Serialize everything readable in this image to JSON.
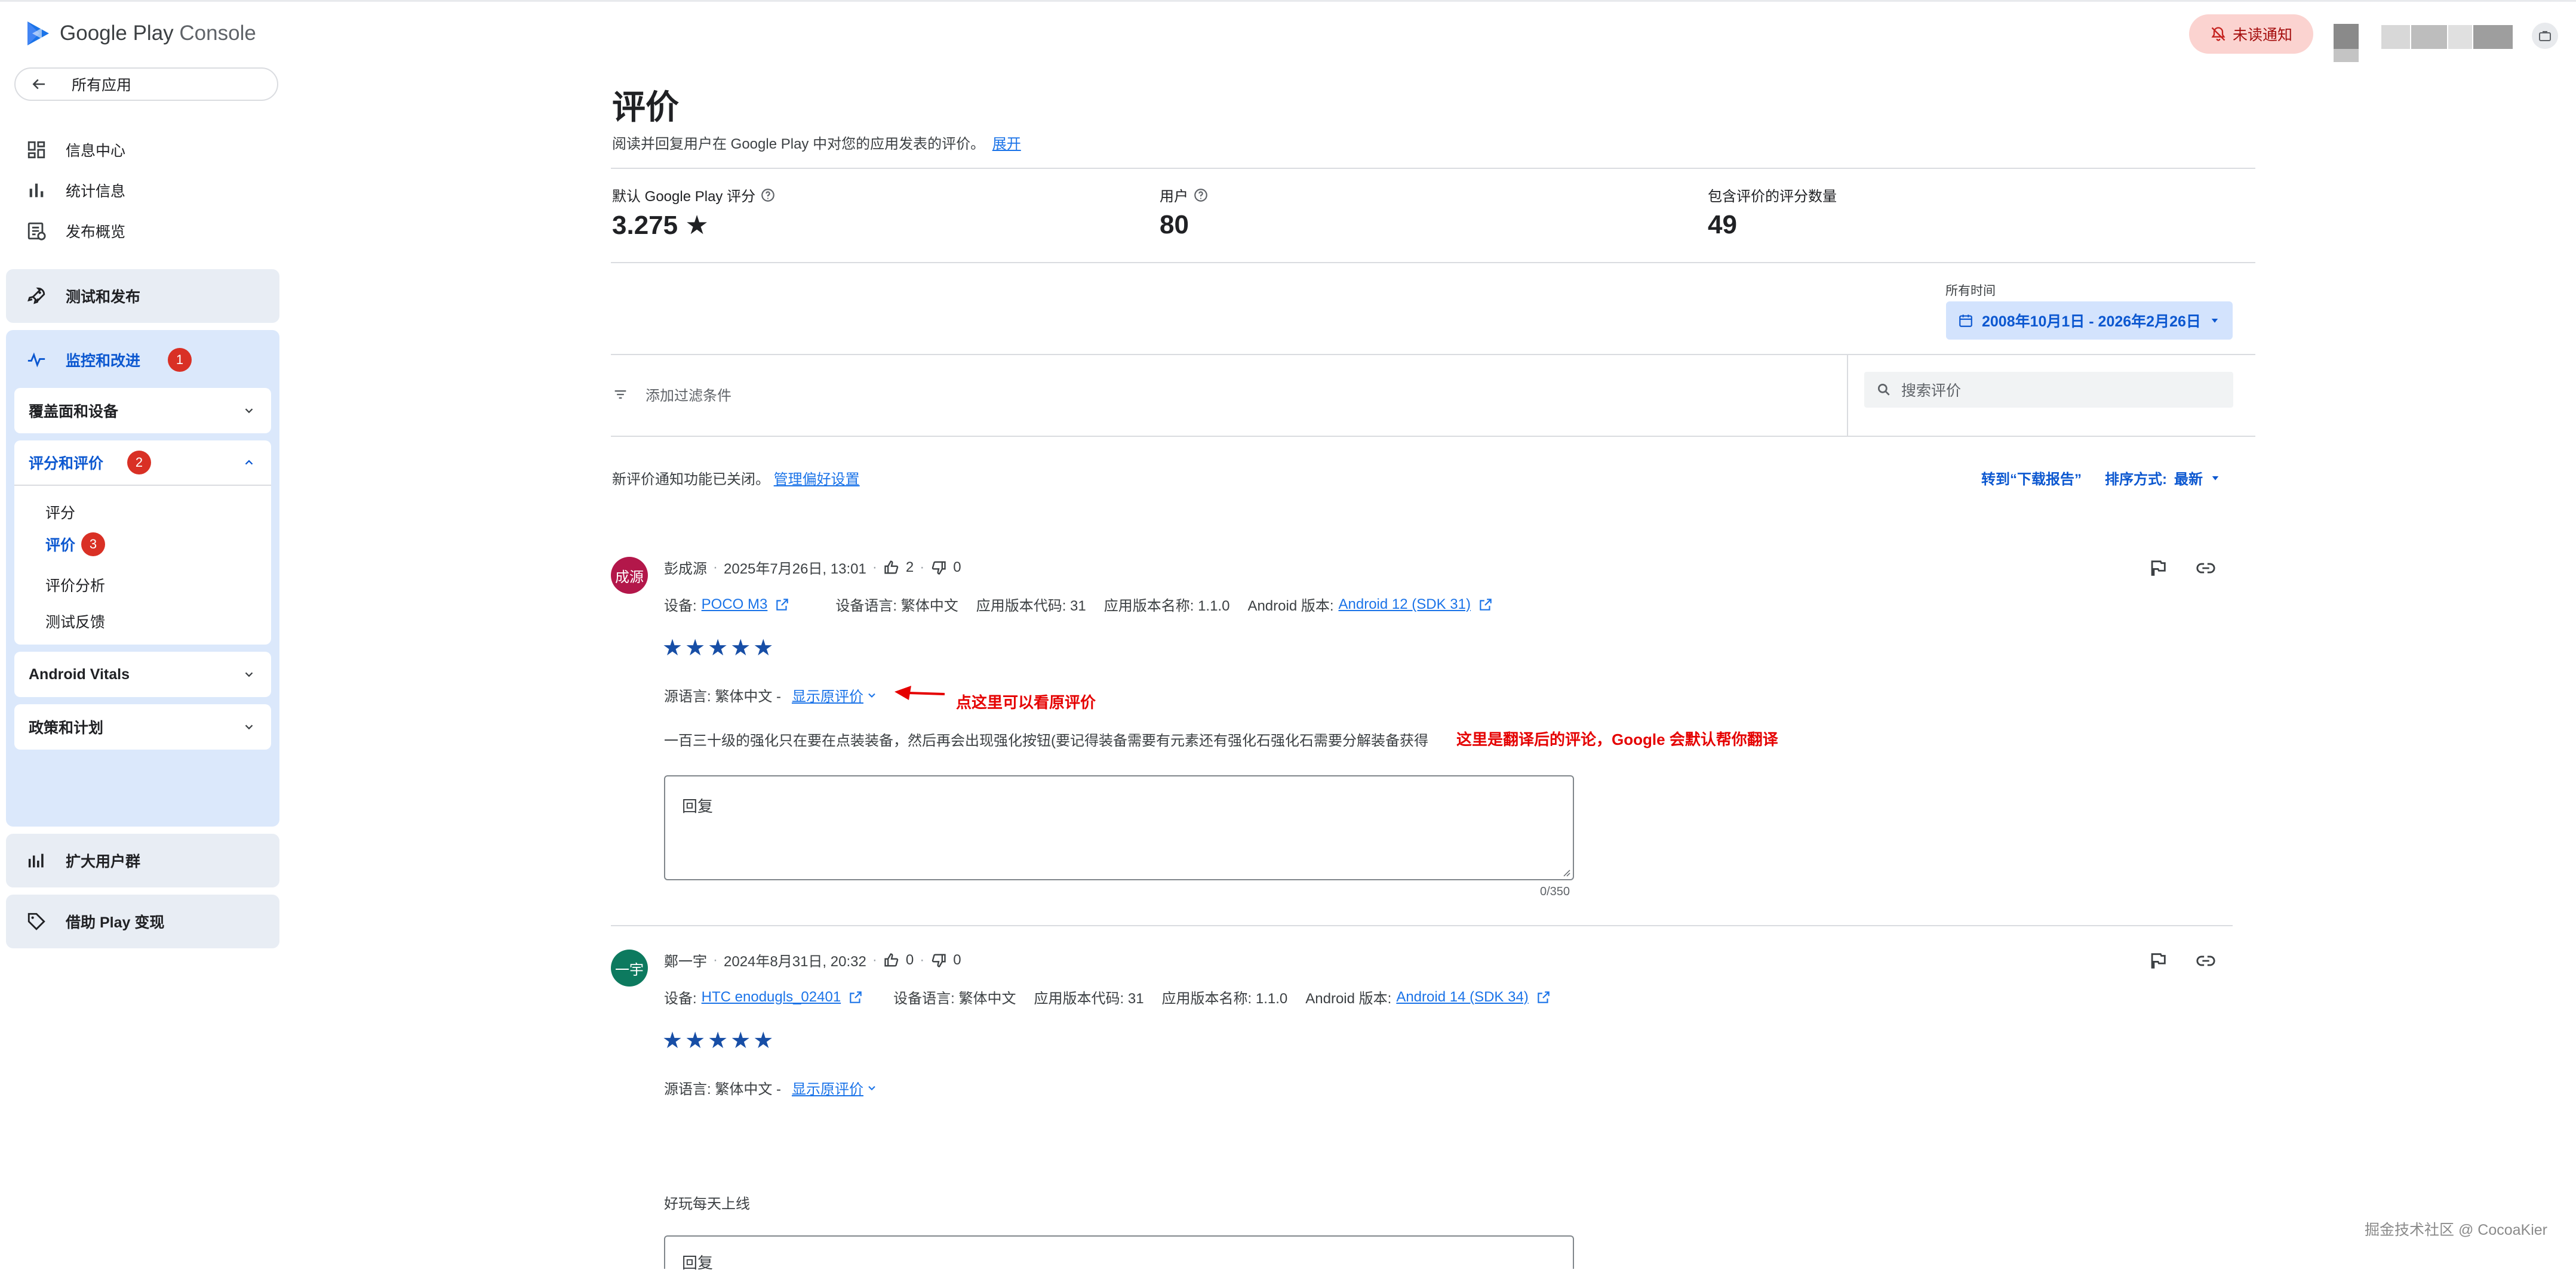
{
  "app": {
    "logo_google": "Google Play",
    "logo_console": "Console"
  },
  "topbar": {
    "notification_label": "未读通知"
  },
  "sidebar": {
    "back_label": "所有应用",
    "items": [
      {
        "label": "信息中心",
        "icon": "dashboard-icon"
      },
      {
        "label": "统计信息",
        "icon": "bar-chart-icon"
      },
      {
        "label": "发布概览",
        "icon": "release-icon"
      }
    ],
    "test_release": "测试和发布",
    "monitor": {
      "label": "监控和改进",
      "badge": "1"
    },
    "coverage": "覆盖面和设备",
    "ratings_section": {
      "label": "评分和评价",
      "badge": "2"
    },
    "sub_items": [
      {
        "label": "评分"
      },
      {
        "label": "评价",
        "badge": "3"
      },
      {
        "label": "评价分析"
      },
      {
        "label": "测试反馈"
      }
    ],
    "android_vitals": "Android Vitals",
    "policy": "政策和计划",
    "grow": "扩大用户群",
    "monetize": "借助 Play 变现"
  },
  "page": {
    "title": "评价",
    "description": "阅读并回复用户在 Google Play 中对您的应用发表的评价。",
    "expand_link": "展开",
    "stats": [
      {
        "label": "默认 Google Play 评分",
        "value": "3.275 ★"
      },
      {
        "label": "用户",
        "value": "80"
      },
      {
        "label": "包含评价的评分数量",
        "value": "49"
      }
    ],
    "time_label": "所有时间",
    "date_range": "2008年10月1日 - 2026年2月26日",
    "filter_label": "添加过滤条件",
    "search_placeholder": "搜索评价",
    "notice_text": "新评价通知功能已关闭。",
    "manage_link": "管理偏好设置",
    "download_report": "转到“下载报告”",
    "sort_label": "排序方式:",
    "sort_value": "最新"
  },
  "reviews": [
    {
      "avatar": "成源",
      "avatar_color": "#b3174a",
      "author": "彭成源",
      "date": "2025年7月26日, 13:01",
      "likes": "2",
      "dislikes": "0",
      "device_label": "设备:",
      "device": "POCO M3",
      "lang_label": "设备语言: 繁体中文",
      "version_code": "应用版本代码: 31",
      "version_name": "应用版本名称: 1.1.0",
      "android_label": "Android 版本:",
      "android": "Android 12 (SDK 31)",
      "stars": "★★★★★",
      "source_lang": "源语言: 繁体中文 -",
      "show_original": "显示原评价",
      "text": "一百三十级的强化只在要在点装装备，然后再会出现强化按钮(要记得装备需要有元素还有强化石强化石需要分解装备获得",
      "reply_placeholder": "回复",
      "counter": "0/350"
    },
    {
      "avatar": "一宇",
      "avatar_color": "#0d7a5f",
      "author": "鄭一宇",
      "date": "2024年8月31日, 20:32",
      "likes": "0",
      "dislikes": "0",
      "device_label": "设备:",
      "device": "HTC enodugls_02401",
      "lang_label": "设备语言: 繁体中文",
      "version_code": "应用版本代码: 31",
      "version_name": "应用版本名称: 1.1.0",
      "android_label": "Android 版本:",
      "android": "Android 14 (SDK 34)",
      "stars": "★★★★★",
      "source_lang": "源语言: 繁体中文 -",
      "show_original": "显示原评价",
      "text": "好玩每天上线",
      "reply_placeholder": "回复"
    }
  ],
  "annotations": {
    "original_hint": "点这里可以看原评价",
    "translate_hint": "这里是翻译后的评论，Google 会默认帮你翻译"
  },
  "watermark": "掘金技术社区 @ CocoaKier",
  "colors": {
    "accent": "#1a73e8",
    "star": "#174ea6",
    "annotation": "#e50000",
    "badge": "#d93025"
  }
}
